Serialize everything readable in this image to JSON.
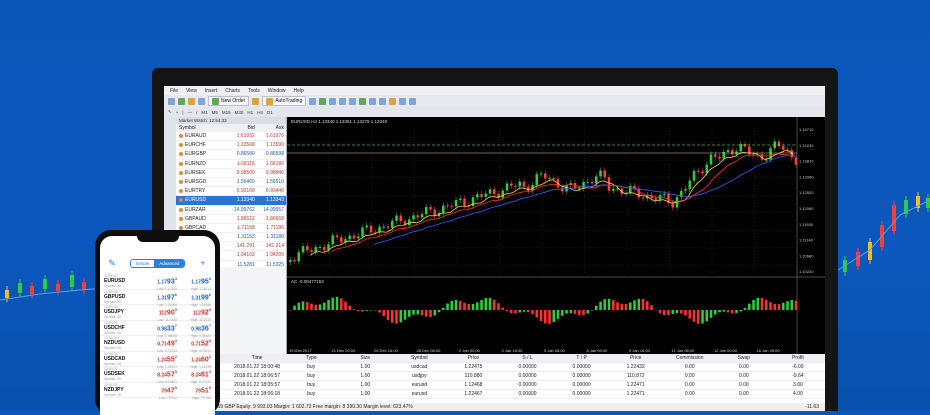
{
  "colors": {
    "background": "#0b57bd",
    "bull": "#2ecc40",
    "bear": "#ff2020",
    "selected": "#2c73d2",
    "phone_accent": "#2b7fd8"
  },
  "menu": [
    "File",
    "View",
    "Insert",
    "Charts",
    "Tools",
    "Window",
    "Help"
  ],
  "toolbar": {
    "new_order": "New Order",
    "autotrading": "AutoTrading"
  },
  "market_watch": {
    "title": "Market Watch: 12:54:33",
    "headers": [
      "Symbol",
      "Bid",
      "Ask"
    ],
    "rows": [
      {
        "symbol": "EURAUD",
        "bid": "1.61932",
        "ask": "1.61976"
      },
      {
        "symbol": "EURCHF",
        "bid": "1.13568",
        "ask": "1.13590"
      },
      {
        "symbol": "EURGBP",
        "bid": "0.86580",
        "ask": "0.86598"
      },
      {
        "symbol": "EURNZD",
        "bid": "1.68115",
        "ask": "1.68180"
      },
      {
        "symbol": "EURSEK",
        "bid": "9.98500",
        "ask": "9.98840"
      },
      {
        "symbol": "EURSGD",
        "bid": "1.56465",
        "ask": "1.56510"
      },
      {
        "symbol": "EURTRY",
        "bid": "6.93160",
        "ask": "6.93440"
      },
      {
        "symbol": "EURUSD",
        "bid": "1.13340",
        "ask": "1.13343",
        "selected": true
      },
      {
        "symbol": "EURZAR",
        "bid": "14.99762",
        "ask": "14.99957"
      },
      {
        "symbol": "GBPAUD",
        "bid": "1.86612",
        "ask": "1.86668"
      },
      {
        "symbol": "GBPCAD",
        "bid": "1.71158",
        "ask": "1.71186"
      },
      {
        "symbol": "GBPCHF",
        "bid": "1.31153",
        "ask": "1.31180"
      },
      {
        "symbol": "GBPJPY",
        "bid": "141.291",
        "ask": "141.314"
      },
      {
        "symbol": "GBPNZD",
        "bid": "1.94163",
        "ask": "1.94200"
      },
      {
        "symbol": "GBPSEK",
        "bid": "11.5281",
        "ask": "11.5325"
      }
    ]
  },
  "chart": {
    "title": "EURUSD,H4 1.13340 1.13361 1.13279 1.13340",
    "indicator_label": "AC -0.00477153",
    "price_labels": [
      "1.14710",
      "1.14230",
      "1.13810",
      "1.13340",
      "1.12520",
      "1.12060",
      "1.11600",
      "1.11140",
      "1.10680",
      "1.10220"
    ],
    "date_labels": [
      "19 Dec 2017",
      "21 Dec 20:00",
      "26 Dec 16:00",
      "28 Dec 08:00",
      "2 Jan 00:00",
      "3 Jan 16:00",
      "5 Jan 08:00",
      "8 Jan 00:00",
      "9 Jan 16:00",
      "11 Jan 08:00",
      "12 Jan 00:00",
      "16 Jan 05:00"
    ]
  },
  "terminal": {
    "headers": [
      "Order",
      "Time",
      "Type",
      "Size",
      "Symbol",
      "Price",
      "S / L",
      "T / P",
      "Price",
      "Commission",
      "Swap",
      "Profit"
    ],
    "rows": [
      [
        "58924718",
        "2018.01.22 18:00:48",
        "buy",
        "1.00",
        "usdcad",
        "1.22475",
        "0.00000",
        "0.00000",
        "1.22432",
        "0.00",
        "0.00",
        "-6.09"
      ],
      [
        "58924790",
        "2018.01.22 18:06:57",
        "buy",
        "1.00",
        "usdjpy",
        "110.880",
        "0.00000",
        "0.00000",
        "110.872",
        "0.00",
        "0.00",
        "-9.64"
      ],
      [
        "58924826",
        "2018.01.22 18:05:57",
        "buy",
        "1.00",
        "eurusd",
        "1.12468",
        "0.00000",
        "0.00000",
        "1.22471",
        "0.00",
        "0.00",
        "3.00"
      ],
      [
        "58924840",
        "2018.01.22 18:06:18",
        "buy",
        "1.00",
        "eurusd",
        "1.22467",
        "0.00000",
        "0.00000",
        "1.22471",
        "0.00",
        "0.00",
        "4.00"
      ]
    ],
    "balance": "Balance: 10 000.69 GBP  Equity: 9 993.03  Margin: 1 602.73  Free margin: 8 390.30  Margin level: 623.47%",
    "total": "-11.63"
  },
  "phone": {
    "tabs": [
      "Simple",
      "Advanced"
    ],
    "rows": [
      {
        "time": "12:54:33",
        "symbol": "EURUSD",
        "spread": "Spread: 30",
        "bid_main": "1.17",
        "bid_big": "93",
        "bid_sup": "3",
        "bid_low": "Low: 1.17468",
        "ask_main": "1.17",
        "ask_big": "95",
        "ask_sup": "3",
        "ask_high": "High: 1.18114",
        "color": "blue"
      },
      {
        "time": "12:54:33",
        "symbol": "GBPUSD",
        "spread": "Spread: 30",
        "bid_main": "1.31",
        "bid_big": "97",
        "bid_sup": "6",
        "bid_low": "Low: 1.31068",
        "ask_main": "1.31",
        "ask_big": "99",
        "ask_sup": "6",
        "ask_high": "High: 1.31845",
        "color": "blue"
      },
      {
        "time": "12:54:33",
        "symbol": "USDJPY",
        "spread": "Spread: 20",
        "bid_main": "112",
        "bid_big": "90",
        "bid_sup": "9",
        "bid_low": "Low: 112.468",
        "ask_main": "112",
        "ask_big": "92",
        "ask_sup": "9",
        "ask_high": "High: 113.075",
        "color": "red"
      },
      {
        "time": "12:54:33",
        "symbol": "USDCHF",
        "spread": "Spread: 30",
        "bid_main": "0.98",
        "bid_big": "33",
        "bid_sup": "7",
        "bid_low": "Low: 0.98045",
        "ask_main": "0.98",
        "ask_big": "36",
        "ask_sup": "7",
        "ask_high": "High: 0.98427",
        "color": "blue"
      },
      {
        "time": "12:54:33",
        "symbol": "NZDUSD",
        "spread": "Spread: 40",
        "bid_main": "0.71",
        "bid_big": "49",
        "bid_sup": "3",
        "bid_low": "Low: 0.71313",
        "ask_main": "0.71",
        "ask_big": "52",
        "ask_sup": "3",
        "ask_high": "High: 0.71671",
        "color": "red"
      },
      {
        "time": "12:54:33",
        "symbol": "USDCAD",
        "spread": "Spread: 40",
        "bid_main": "1.24",
        "bid_big": "55",
        "bid_sup": "2",
        "bid_low": "Low: 1.24331",
        "ask_main": "1.24",
        "ask_big": "60",
        "ask_sup": "2",
        "ask_high": "High: 1.24729",
        "color": "red"
      },
      {
        "time": "12:54:33",
        "symbol": "USDSEK",
        "spread": "Spread: 60",
        "bid_main": "8.24",
        "bid_big": "57",
        "bid_sup": "3",
        "bid_low": "Low: 8.22901",
        "ask_main": "8.24",
        "ask_big": "61",
        "ask_sup": "3",
        "ask_high": "High: 8.27131",
        "color": "red"
      },
      {
        "time": "12:54:33",
        "symbol": "NZDJPY",
        "spread": "Spread: 20",
        "bid_main": "79",
        "bid_big": "47",
        "bid_sup": "9",
        "bid_low": "Low: 79.212",
        "ask_main": "79",
        "ask_big": "51",
        "ask_sup": "9",
        "ask_high": "High: 79.768",
        "color": "red"
      }
    ]
  }
}
